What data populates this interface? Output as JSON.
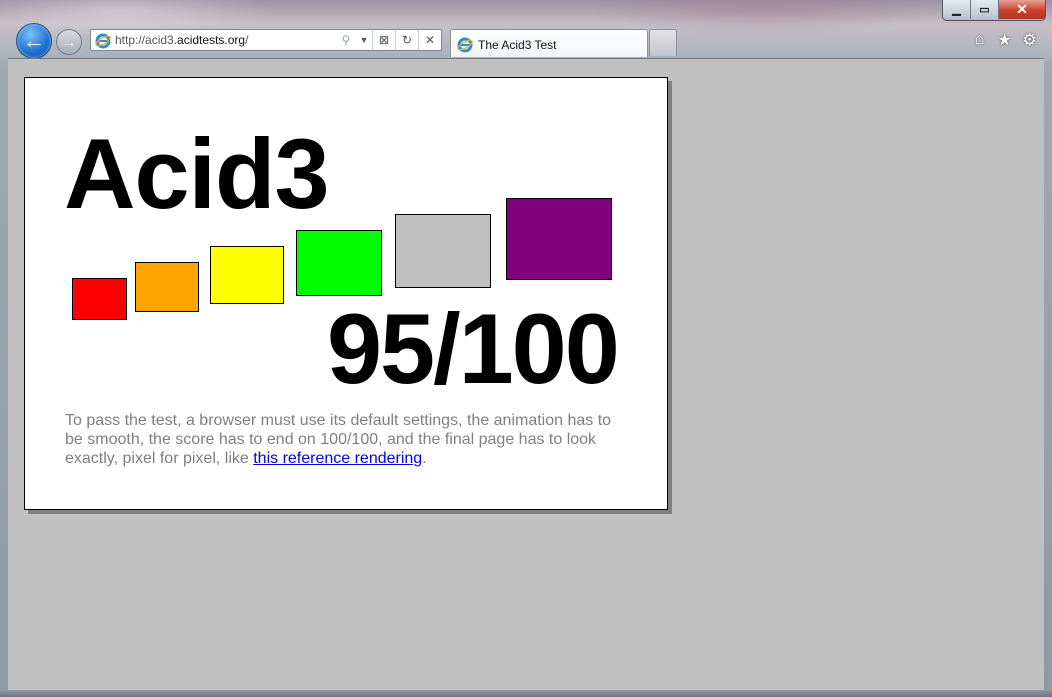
{
  "window": {
    "minimize_glyph": "▁",
    "maximize_glyph": "▭",
    "close_glyph": "✕"
  },
  "nav": {
    "back_glyph": "←",
    "forward_glyph": "→",
    "address_prefix": "http://acid3.",
    "address_domain": "acidtests.org",
    "address_suffix": "/",
    "search_glyph": "⚲",
    "dropdown_glyph": "▼",
    "compat_glyph": "⊠",
    "refresh_glyph": "↻",
    "stop_glyph": "✕"
  },
  "tabs": [
    {
      "label": "The Acid3 Test"
    }
  ],
  "command_icons": [
    {
      "name": "home-icon",
      "glyph": "⌂"
    },
    {
      "name": "favorites-icon",
      "glyph": "★"
    },
    {
      "name": "tools-icon",
      "glyph": "⚙"
    }
  ],
  "page": {
    "title": "Acid3",
    "score": "95/100",
    "note_text": "To pass the test, a browser must use its default settings, the animation has to be smooth, the score has to end on 100/100, and the final page has to look exactly, pixel for pixel, like ",
    "note_link": "this reference rendering",
    "note_end": ".",
    "buckets": [
      {
        "name": "bucket-1",
        "color": "#ff0000"
      },
      {
        "name": "bucket-2",
        "color": "#ffa500"
      },
      {
        "name": "bucket-3",
        "color": "#ffff00"
      },
      {
        "name": "bucket-4",
        "color": "#00ff00"
      },
      {
        "name": "bucket-5",
        "color": "#c0c0c0"
      },
      {
        "name": "bucket-6",
        "color": "#800080"
      }
    ]
  },
  "colors": {
    "viewport_bg": "#c0c0c0",
    "link": "#0000ee",
    "note_text": "#808080"
  }
}
